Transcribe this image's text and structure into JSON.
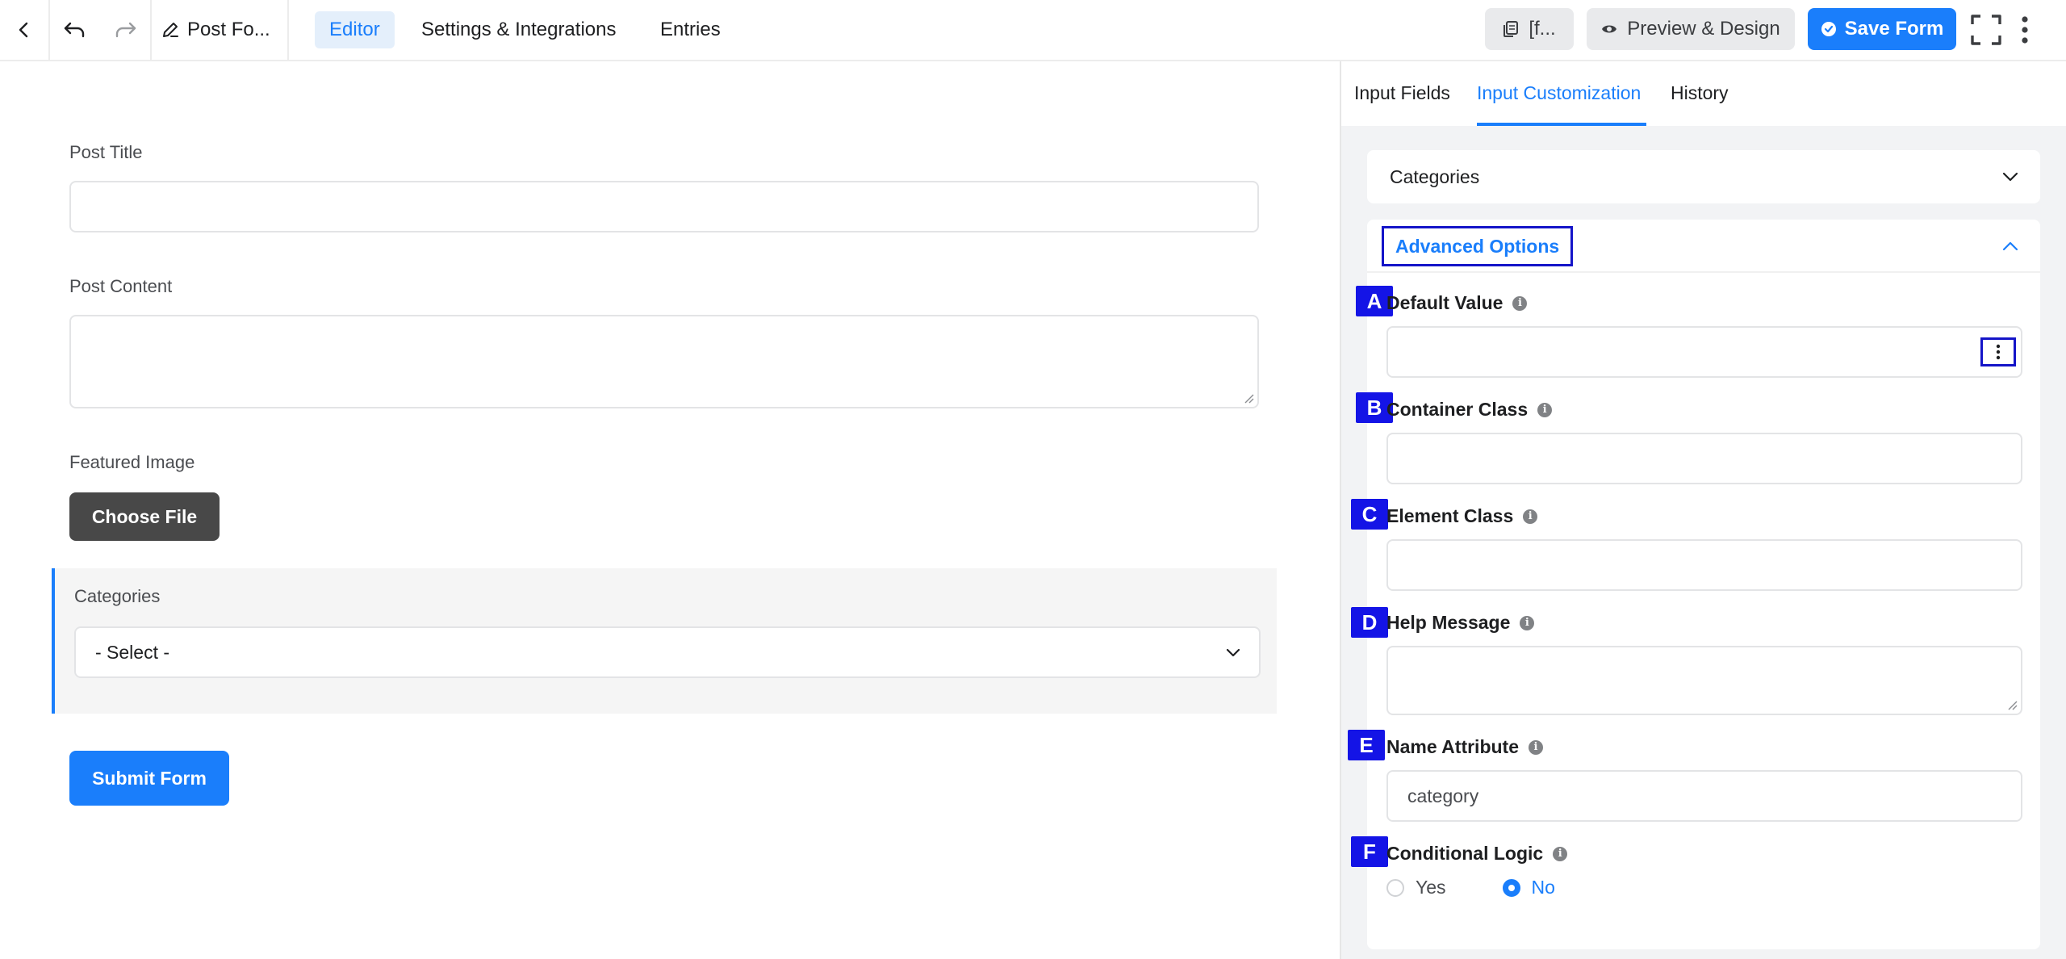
{
  "topbar": {
    "doc_title": "Post Fo...",
    "tabs": [
      {
        "label": "Editor",
        "active": true
      },
      {
        "label": "Settings & Integrations",
        "active": false
      },
      {
        "label": "Entries",
        "active": false
      }
    ],
    "shortcode_label": "[f...",
    "preview_label": "Preview & Design",
    "save_label": "Save Form",
    "accent_color": "#1a7efb"
  },
  "form": {
    "post_title_label": "Post Title",
    "post_title_value": "",
    "post_content_label": "Post Content",
    "post_content_value": "",
    "featured_image_label": "Featured Image",
    "choose_file_label": "Choose File",
    "categories_label": "Categories",
    "categories_selected": "- Select -",
    "submit_label": "Submit Form"
  },
  "sidebar": {
    "tabs": [
      {
        "label": "Input Fields",
        "active": false
      },
      {
        "label": "Input Customization",
        "active": true
      },
      {
        "label": "History",
        "active": false
      }
    ],
    "categories_panel_title": "Categories",
    "advanced_options": {
      "title": "Advanced Options",
      "fields": [
        {
          "badge": "A",
          "label": "Default Value",
          "value": ""
        },
        {
          "badge": "B",
          "label": "Container Class",
          "value": ""
        },
        {
          "badge": "C",
          "label": "Element Class",
          "value": ""
        },
        {
          "badge": "D",
          "label": "Help Message",
          "value": ""
        },
        {
          "badge": "E",
          "label": "Name Attribute",
          "value": "category"
        },
        {
          "badge": "F",
          "label": "Conditional Logic",
          "value": "No"
        }
      ],
      "conditional_options": [
        "Yes",
        "No"
      ]
    }
  }
}
